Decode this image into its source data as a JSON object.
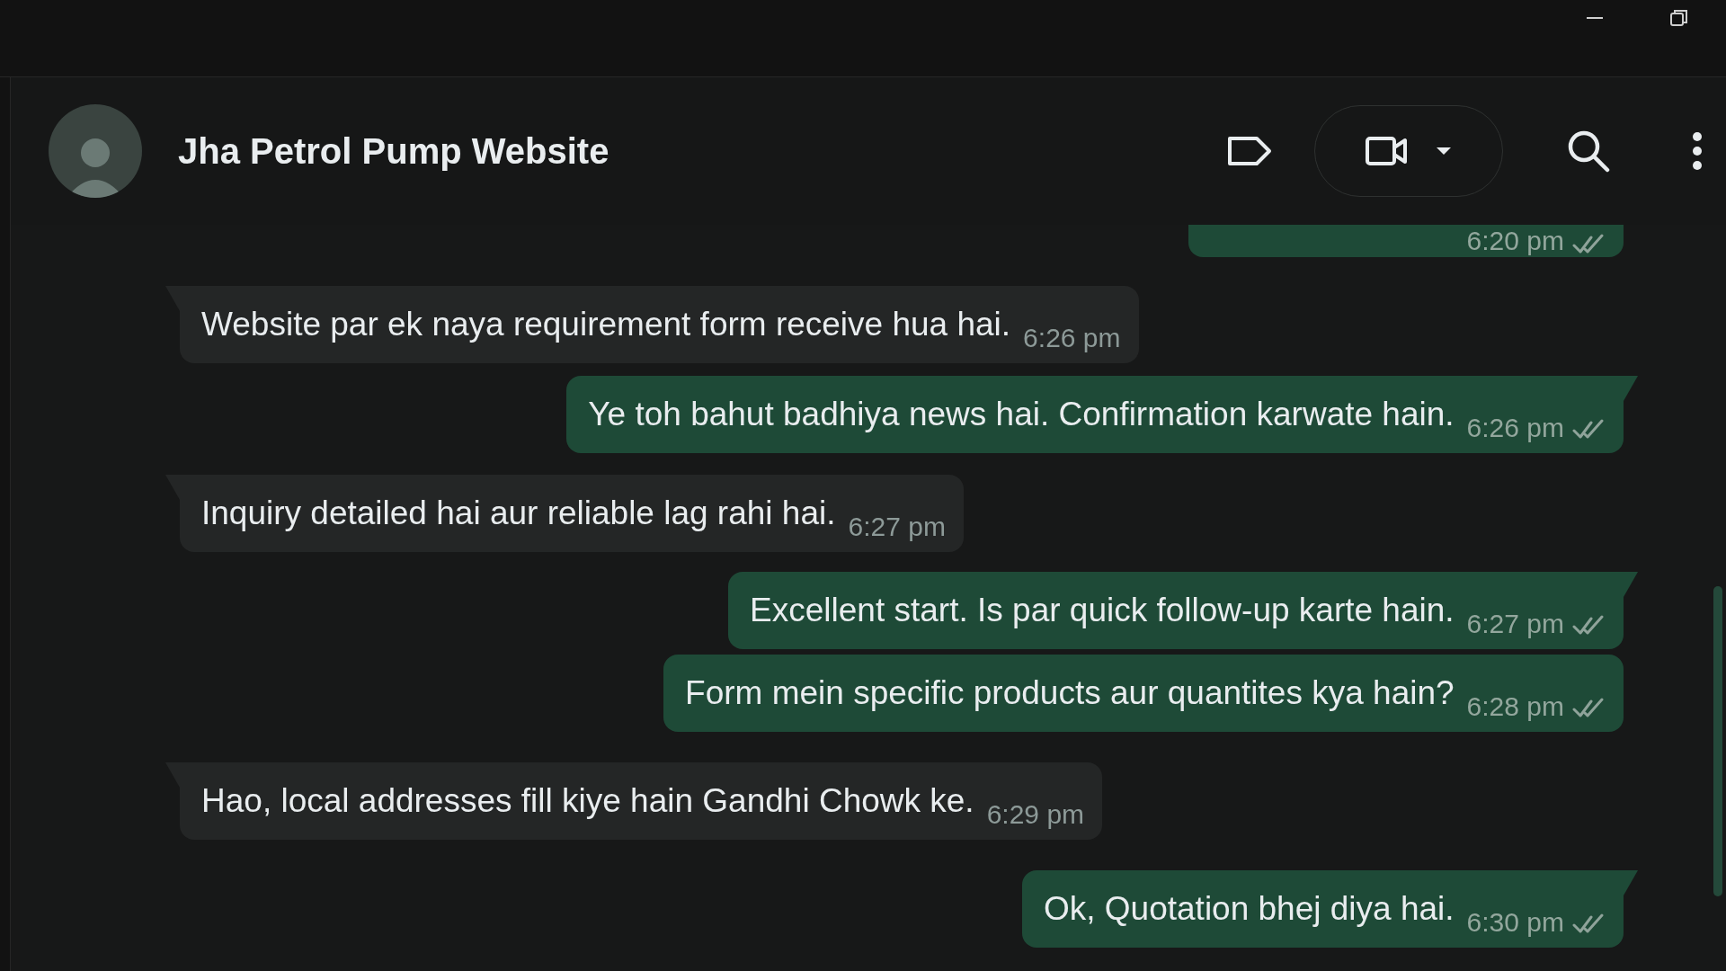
{
  "chat": {
    "title": "Jha Petrol Pump Website"
  },
  "previous_message": {
    "time": "6:20 pm",
    "read": false
  },
  "messages": [
    {
      "kind": "incoming",
      "text": "Website par ek naya requirement form receive hua hai.",
      "time": "6:26 pm"
    },
    {
      "kind": "outgoing",
      "text": "Ye toh bahut badhiya news hai. Confirmation karwate hain.",
      "time": "6:26 pm",
      "read": false
    },
    {
      "kind": "incoming",
      "text": "Inquiry detailed hai aur reliable lag rahi hai.",
      "time": "6:27 pm"
    },
    {
      "kind": "outgoing",
      "text": "Excellent start. Is par quick follow-up karte hain.",
      "time": "6:27 pm",
      "read": false
    },
    {
      "kind": "outgoing",
      "text": "Form mein specific products aur quantites kya hain?",
      "time": "6:28 pm",
      "read": false
    },
    {
      "kind": "incoming",
      "text": "Hao, local addresses fill kiye hain Gandhi Chowk ke.",
      "time": "6:29 pm"
    },
    {
      "kind": "outgoing",
      "text": "Ok, Quotation bhej diya hai.",
      "time": "6:30 pm",
      "read": false
    }
  ]
}
